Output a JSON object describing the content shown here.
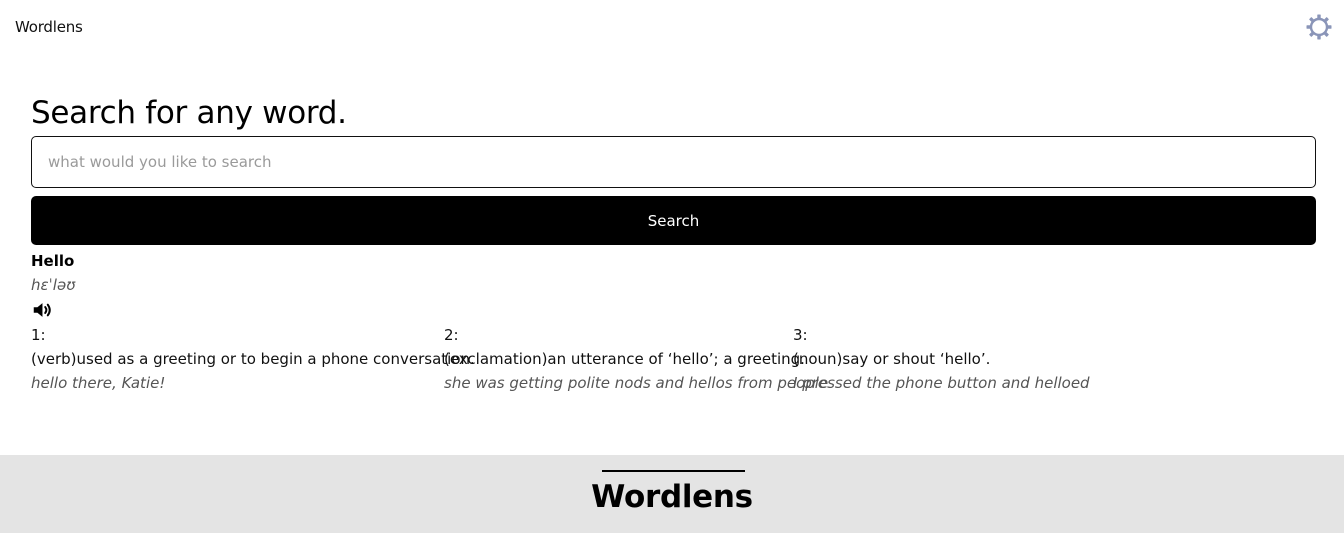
{
  "header": {
    "brand": "Wordlens",
    "settings_icon": "gear-icon"
  },
  "search": {
    "heading": "Search for any word.",
    "placeholder": "what would you like to search",
    "value": "",
    "button_label": "Search"
  },
  "result": {
    "word": "Hello",
    "phonetic": "hɛˈləʊ",
    "audio_icon": "speaker-icon",
    "meanings": [
      {
        "number": "1:",
        "definition": "(verb)used as a greeting or to begin a phone conversation.",
        "example": "hello there, Katie!"
      },
      {
        "number": "2:",
        "definition": "(exclamation)an utterance of ‘hello’; a greeting.",
        "example": "she was getting polite nods and hellos from people"
      },
      {
        "number": "3:",
        "definition": "(noun)say or shout ‘hello’.",
        "example": "I pressed the phone button and helloed"
      }
    ]
  },
  "footer": {
    "title": "Wordlens"
  },
  "colors": {
    "accent_icon": "#8a95b8",
    "button_bg": "#000000",
    "footer_bg": "#e4e4e4"
  }
}
